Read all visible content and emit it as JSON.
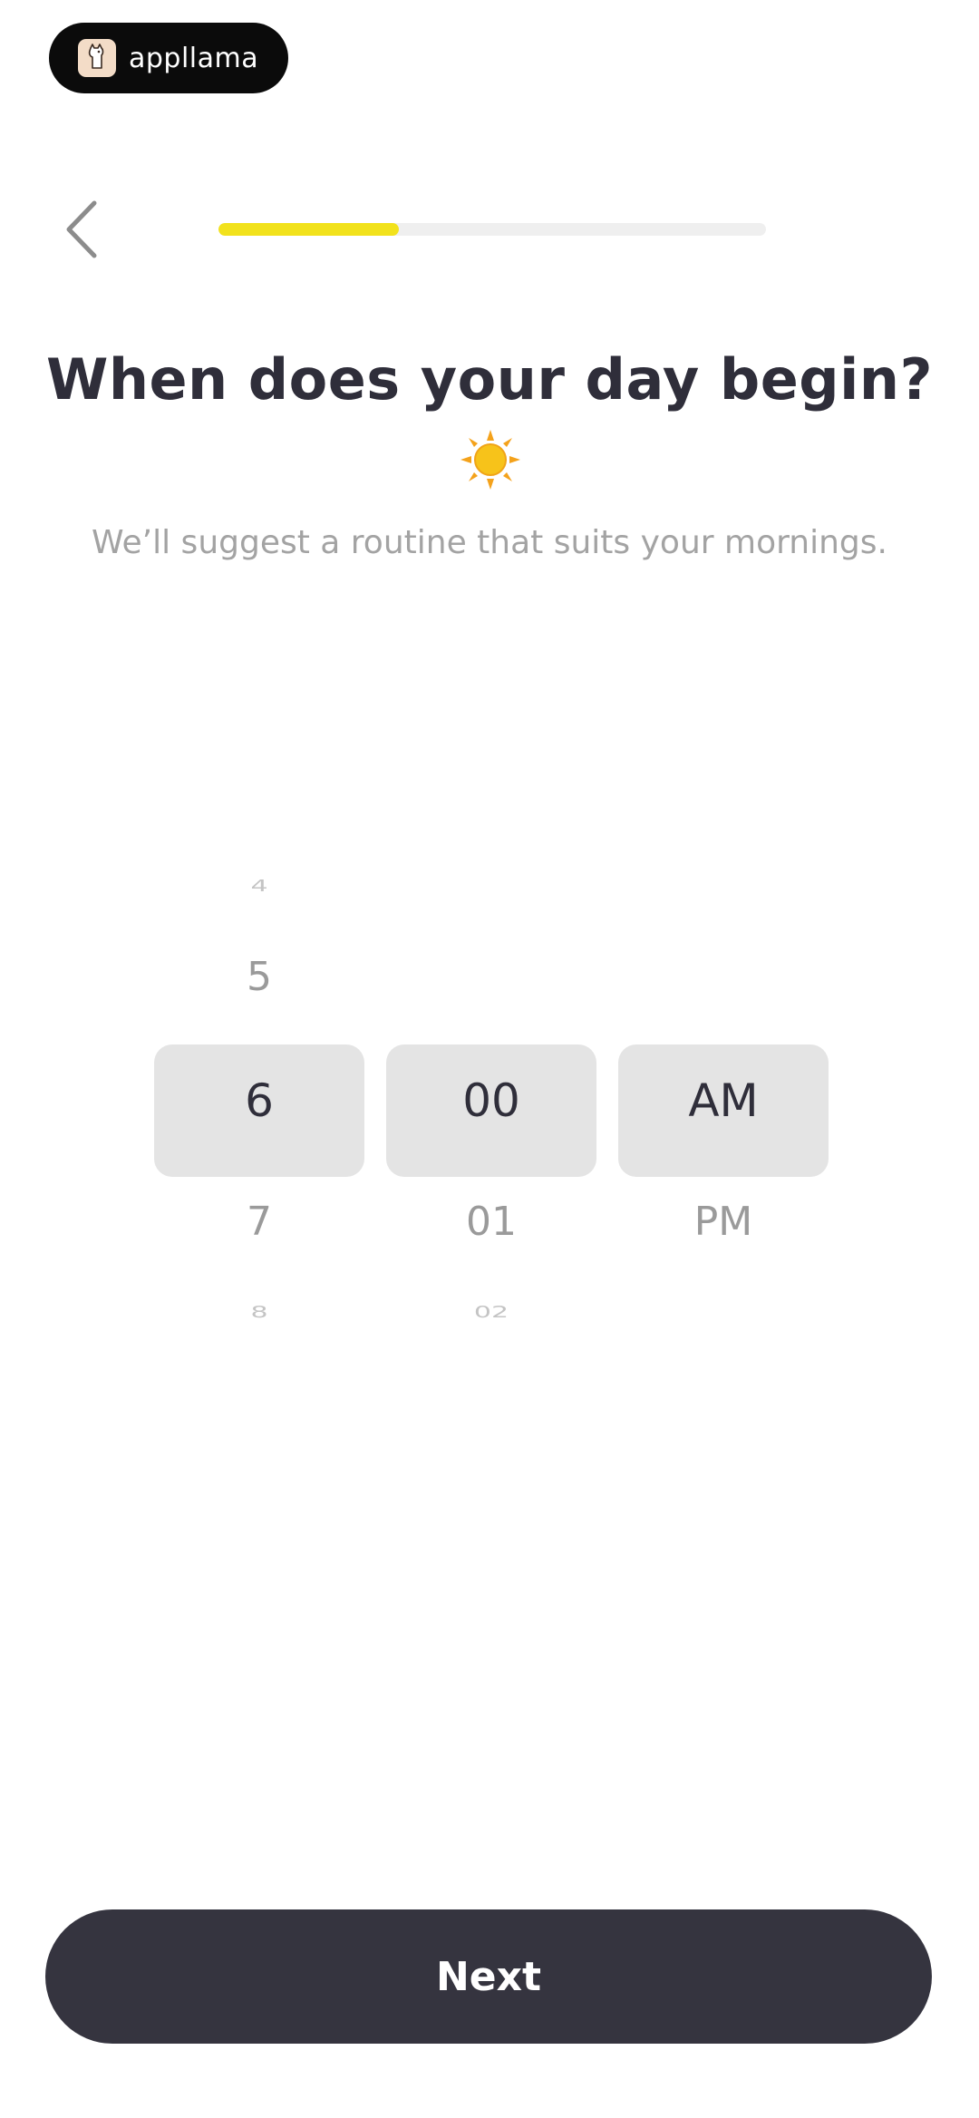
{
  "brand": {
    "name": "appllama",
    "logo_icon": "llama-icon"
  },
  "header": {
    "back_icon": "chevron-left-icon",
    "progress": 0.33
  },
  "main": {
    "title": "When does your day begin?",
    "emoji": "sun-icon",
    "subtitle": "We’ll suggest a routine that suits your mornings."
  },
  "picker": {
    "hour": {
      "far_up": "4",
      "near_up": "5",
      "selected": "6",
      "near_down": "7",
      "far_down": "8"
    },
    "minute": {
      "selected": "00",
      "near_down": "01",
      "far_down": "02"
    },
    "period": {
      "selected": "AM",
      "near_down": "PM"
    }
  },
  "footer": {
    "next_label": "Next"
  },
  "colors": {
    "accent": "#f2e21c",
    "button": "#35343f",
    "text_dark": "#2f2e3a"
  }
}
